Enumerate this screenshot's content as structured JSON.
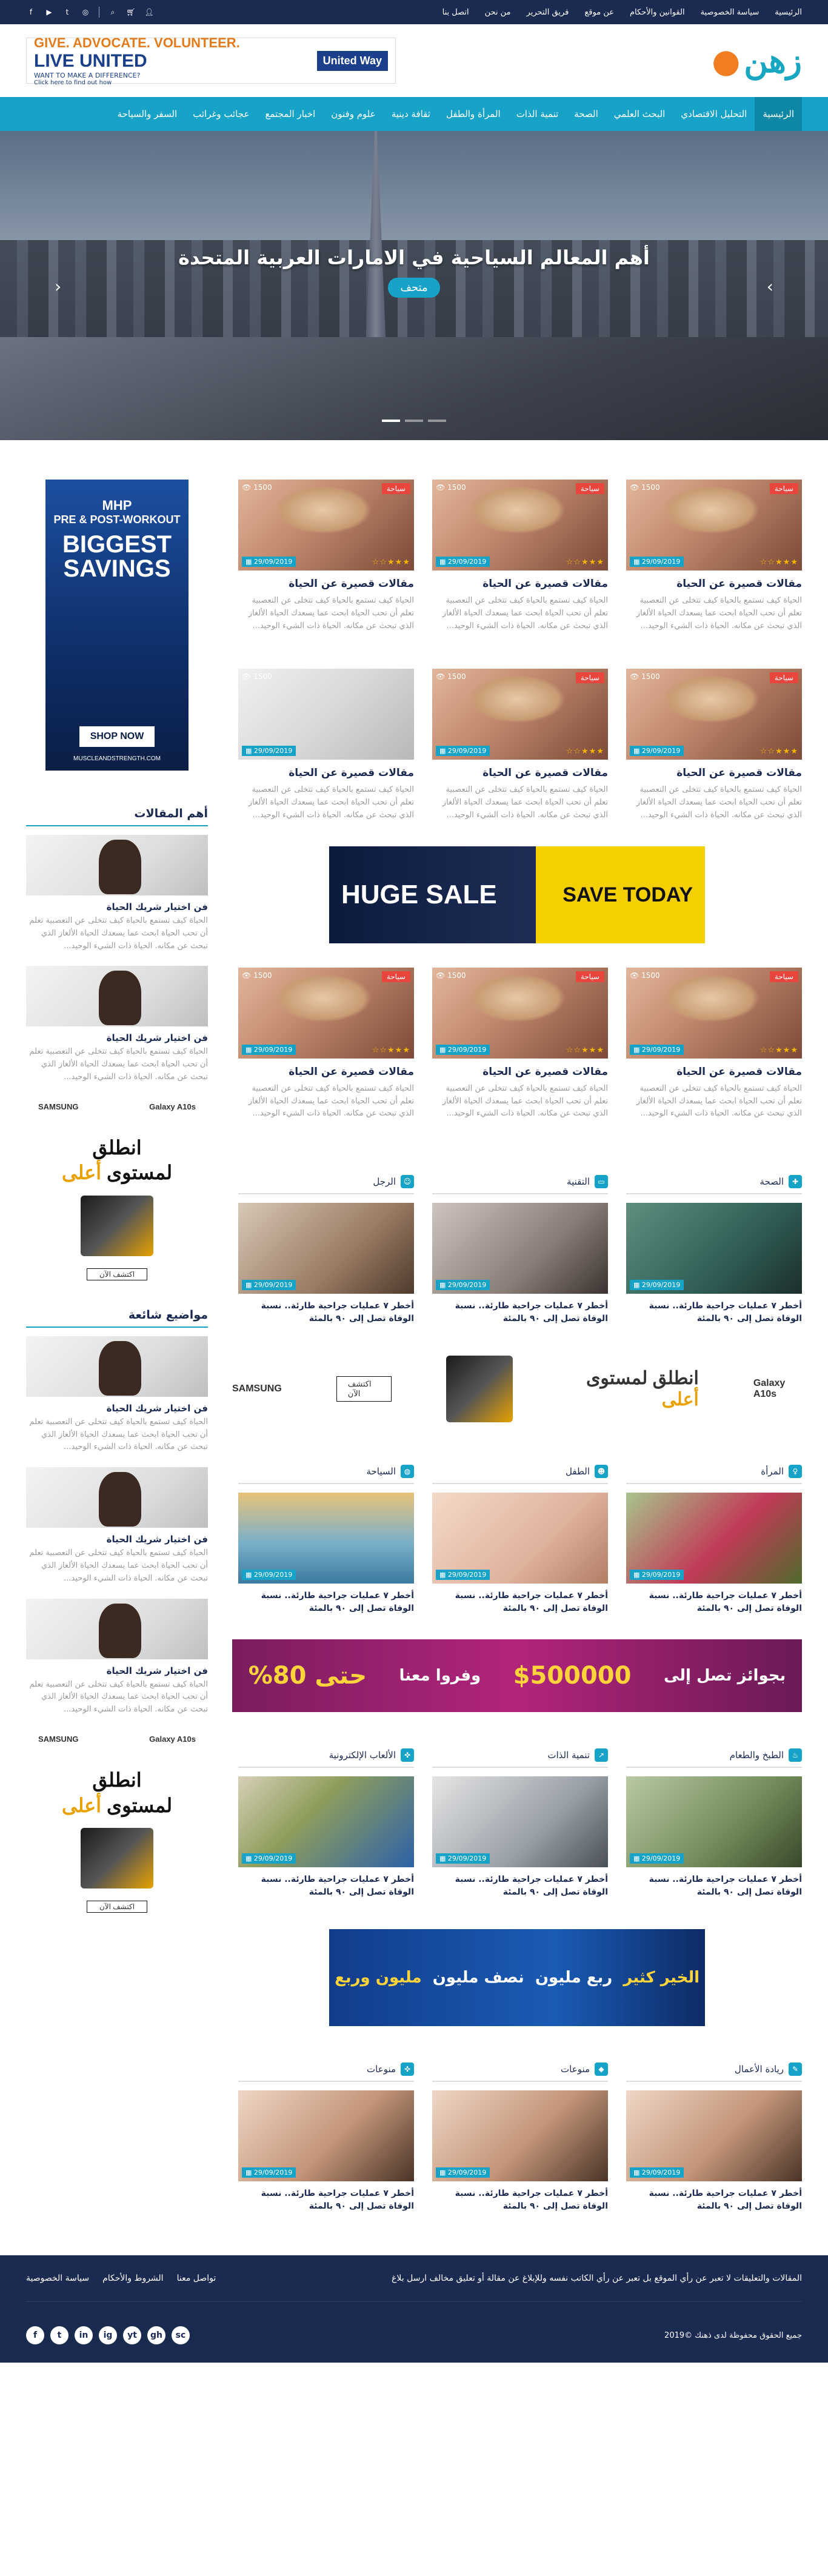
{
  "topbar": {
    "links": [
      "الرئيسية",
      "سياسة الخصوصية",
      "القوانين والأحكام",
      "عن موقع",
      "فريق التحرير",
      "من نحن",
      "اتصل بنا"
    ],
    "icons": [
      "facebook-icon",
      "youtube-icon",
      "twitter-icon",
      "instagram-icon",
      "search-icon",
      "cart-icon",
      "user-icon"
    ]
  },
  "header": {
    "logo": "زهن",
    "ad_line1": "GIVE. ADVOCATE. VOLUNTEER.",
    "ad_line2": "LIVE UNITED",
    "ad_line3": "WANT TO MAKE A DIFFERENCE?",
    "ad_line4": "Click here to find out how",
    "ad_badge": "United Way"
  },
  "nav": {
    "items": [
      "الرئيسية",
      "التحليل الاقتصادي",
      "البحث العلمي",
      "الصحة",
      "تنمية الذات",
      "المرأة والطفل",
      "ثقافة دينية",
      "علوم وفنون",
      "اخبار المجتمع",
      "عجائب وغرائب",
      "السفر والسياحة"
    ]
  },
  "hero": {
    "title": "أهم المعالم السياحية في الامارات العربية المتحدة",
    "tag": "متحف"
  },
  "card": {
    "category": "سياحة",
    "views": "1500",
    "date": "29/09/2019",
    "stars": "★★★☆☆",
    "title": "مقالات قصيرة عن الحياة",
    "excerpt": "الحياة كيف تستمع بالحياة كيف تتخلى عن التعصبية تعلم أن تحب الحياة ابحث عما يسعدك الحياة الألغاز الذي تبحث عن مكانه. الحياة ذات الشيء الوحيد..."
  },
  "ads": {
    "side_brand": "MHP",
    "side_tall_1": "PRE & POST-WORKOUT",
    "side_tall_2": "BIGGEST SAVINGS",
    "side_tall_btn": "SHOP NOW",
    "side_tall_url": "MUSCLEANDSTRENGTH.COM",
    "content_1_l": "HUGE SALE",
    "content_1_r": "SAVE TODAY",
    "samsung_brand": "SAMSUNG",
    "samsung_model": "Galaxy A10s",
    "samsung_model_side": "Galaxy A10s",
    "samsung_line1": "انطلق",
    "samsung_line2": "لمستوى",
    "samsung_line3": "أعلى",
    "samsung_btn": "اكتشف الآن",
    "promo_1": "بجوائز تصل إلى",
    "promo_2": "$500000",
    "promo_3": "وفروا معنا",
    "promo_4": "حتى 80%",
    "blue_1": "مليون وربع",
    "blue_2": "نصف مليون",
    "blue_3": "ربع مليون",
    "blue_4": "الخير كثير"
  },
  "sidebar": {
    "top_articles_title": "أهم المقالات",
    "trending_title": "مواضيع شائعة",
    "item_title": "فن اختيار شريك الحياة",
    "item_excerpt": "الحياة كيف تستمع بالحياة كيف تتخلى عن التعصبية تعلم أن تحب الحياة ابحث عما يسعدك الحياة الألغاز الذي تبحث عن مكانه. الحياة ذات الشيء الوحيد..."
  },
  "categories": {
    "row1": [
      "الصحة",
      "التقنية",
      "الرجل"
    ],
    "row2": [
      "المرأة",
      "الطفل",
      "السياحة"
    ],
    "row3": [
      "الطبخ والطعام",
      "تنمية الذات",
      "الألعاب الإلكترونية"
    ],
    "row4": [
      "ريادة الأعمال",
      "منوعات",
      "منوعات"
    ],
    "item_date": "29/09/2019",
    "item_title": "أخطر ٧ عمليات جراحية طارئة.. نسبة الوفاة تصل إلى ٩٠ بالمئة"
  },
  "footer": {
    "notice": "المقالات والتعليقات لا تعبر عن رأي الموقع بل تعبر عن رأي الكاتب نفسه وللإبلاغ عن مقالة أو تعليق مخالف ارسل بلاغ",
    "links": [
      "تواصل معنا",
      "الشروط والأحكام",
      "سياسة الخصوصية"
    ],
    "copyright": "جميع الحقوق محفوظة لدى ذهنك ©2019",
    "social": [
      "f",
      "t",
      "in",
      "ig",
      "yt",
      "gh",
      "sc"
    ]
  }
}
